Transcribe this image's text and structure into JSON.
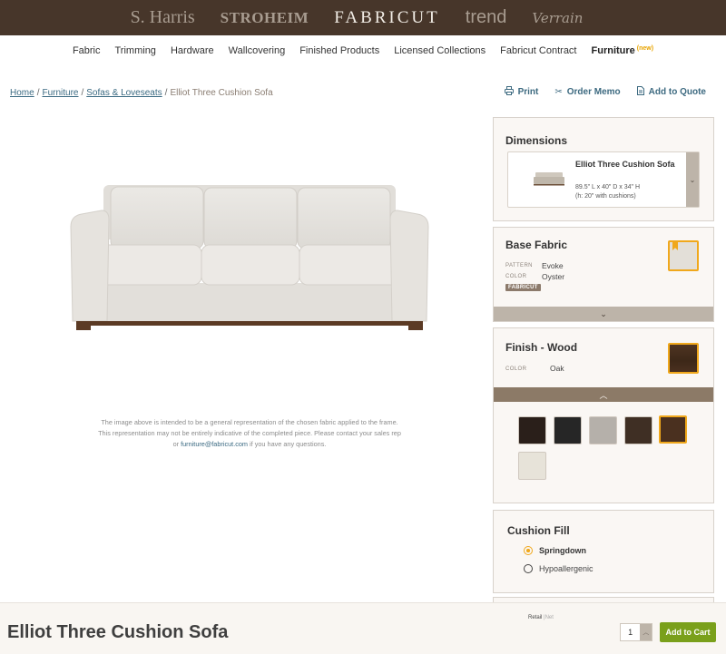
{
  "brands": [
    "S. Harris",
    "STROHEIM",
    "FABRICUT",
    "trend",
    "Verrain"
  ],
  "nav": {
    "items": [
      "Fabric",
      "Trimming",
      "Hardware",
      "Wallcovering",
      "Finished Products",
      "Licensed Collections",
      "Fabricut Contract",
      "Furniture"
    ],
    "active": "Furniture",
    "new_badge": "(new)"
  },
  "breadcrumb": {
    "links": [
      "Home",
      "Furniture",
      "Sofas & Loveseats"
    ],
    "current": "Elliot Three Cushion Sofa",
    "separator": "/"
  },
  "actions": {
    "print": "Print",
    "order_memo": "Order Memo",
    "add_to_quote": "Add to Quote"
  },
  "disclaimer": {
    "line1": "The image above is intended to be a general representation of the chosen fabric applied to the frame.",
    "line2": "This representation may not be entirely indicative of the completed piece. Please contact your sales rep",
    "line3_prefix": "or ",
    "email": "furniture@fabricut.com",
    "line3_suffix": " if you have any questions."
  },
  "dimensions": {
    "title": "Dimensions",
    "product_name": "Elliot Three Cushion Sofa",
    "size": "89.5\" L x 40\" D x 34\" H",
    "height_note": "(h: 20\" with cushions)",
    "toggle_icon": "chevron-down"
  },
  "base_fabric": {
    "title": "Base Fabric",
    "pattern_label": "PATTERN",
    "pattern": "Evoke",
    "color_label": "COLOR",
    "color": "Oyster",
    "brand_tag": "FABRICUT",
    "swatch_color": "#e3dfd8"
  },
  "finish_wood": {
    "title": "Finish - Wood",
    "color_label": "COLOR",
    "color": "Oak",
    "swatches": [
      {
        "color": "#2a1f1a",
        "selected": false
      },
      {
        "color": "#262626",
        "selected": false
      },
      {
        "color": "#b5b0aa",
        "selected": false
      },
      {
        "color": "#3f2f24",
        "selected": false
      },
      {
        "color": "#4a301f",
        "selected": true
      },
      {
        "color": "#e7e3d9",
        "selected": false
      }
    ]
  },
  "cushion_fill": {
    "title": "Cushion Fill",
    "options": [
      {
        "label": "Springdown",
        "checked": true
      },
      {
        "label": "Hypoallergenic",
        "checked": false
      }
    ]
  },
  "bottom": {
    "product_title": "Elliot Three Cushion Sofa",
    "price_retail": "Retail",
    "price_sep": "|",
    "price_net": "Net",
    "quantity": "1",
    "add_to_cart": "Add to Cart"
  },
  "colors": {
    "brand_bar": "#47362a",
    "accent": "#f0a81c",
    "link": "#3b6a82",
    "cart_button": "#7aa01b"
  }
}
